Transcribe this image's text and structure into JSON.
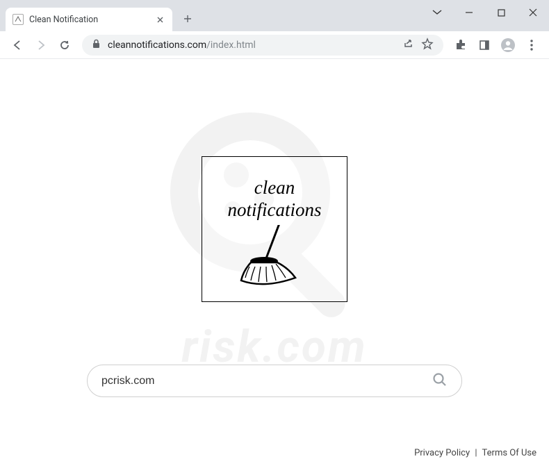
{
  "window": {
    "tab_title": "Clean Notification"
  },
  "address": {
    "domain": "cleannotifications.com",
    "path": "/index.html"
  },
  "logo": {
    "line1": "clean",
    "line2": "notifications"
  },
  "search": {
    "value": "pcrisk.com",
    "placeholder": ""
  },
  "footer": {
    "privacy": "Privacy Policy",
    "terms": "Terms Of Use"
  },
  "watermark": {
    "text": "risk.com"
  }
}
